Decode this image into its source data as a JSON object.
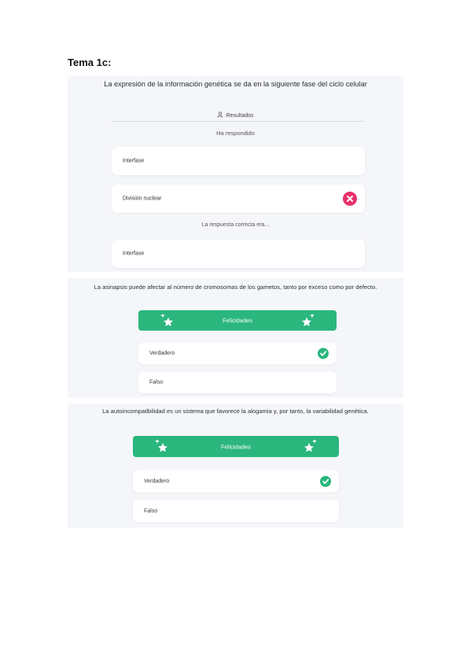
{
  "doc": {
    "title": "Tema 1c:"
  },
  "q1": {
    "question": "La expresión de la información genética se da en la siguiente fase del ciclo celular",
    "results_label": "Resultados",
    "answered_label": "Ha respondido",
    "options": [
      "Interfase",
      "División nuclear"
    ],
    "correct_label": "La respuesta correcta era...",
    "correct_answer": "Interfase",
    "colors": {
      "wrong": "#e8316b"
    }
  },
  "q2": {
    "question": "La asinapsis puede afectar al número de cromosomas de los gametos, tanto por exceso como por defecto.",
    "banner": "Felicidades",
    "options": [
      "Verdadero",
      "Falso"
    ],
    "colors": {
      "success": "#2bb67d"
    }
  },
  "q3": {
    "question": "La autoincompatibilidad es un sistema que favorece la alogamia y, por tanto, la variabilidad genética.",
    "banner": "Felicidades",
    "options": [
      "Verdadero",
      "Falso"
    ]
  }
}
